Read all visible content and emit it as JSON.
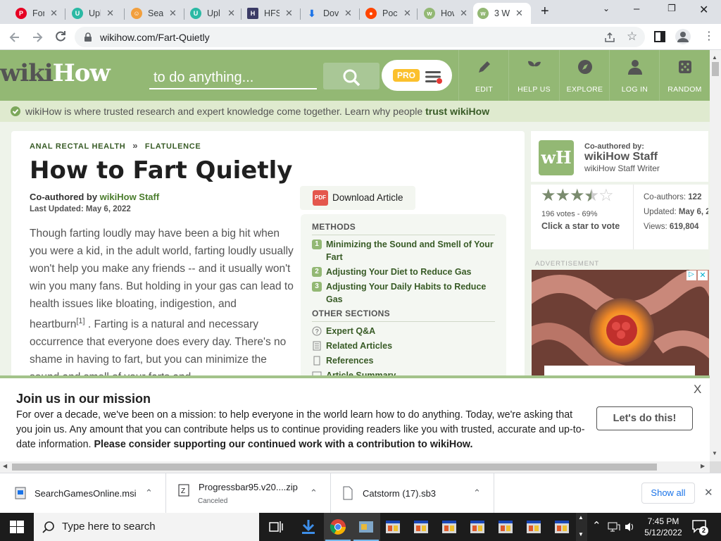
{
  "browser": {
    "tabs": [
      {
        "title": "For",
        "icon": "pinterest-icon",
        "color": "#e60023"
      },
      {
        "title": "Upl",
        "icon": "upload-site-icon",
        "color": "#2bb9a4"
      },
      {
        "title": "Sea",
        "icon": "person-icon",
        "color": "#f29f3d"
      },
      {
        "title": "Upl",
        "icon": "upload-site-icon",
        "color": "#2bb9a4"
      },
      {
        "title": "HFS",
        "icon": "hfs-icon",
        "color": "#3b3b66"
      },
      {
        "title": "Dov",
        "icon": "download-arrow-icon",
        "color": "#1a73e8"
      },
      {
        "title": "Poc",
        "icon": "reddit-icon",
        "color": "#ff4500"
      },
      {
        "title": "How",
        "icon": "wikihow-icon",
        "color": "#93b874"
      },
      {
        "title": "3 W",
        "icon": "wikihow-icon",
        "color": "#93b874",
        "active": true
      }
    ],
    "url": "wikihow.com/Fart-Quietly"
  },
  "site": {
    "logo_dark": "wiki",
    "logo_light": "How",
    "search_placeholder": "to do anything...",
    "pro_label": "PRO",
    "nav": [
      {
        "label": "EDIT",
        "icon": "pencil-icon"
      },
      {
        "label": "HELP US",
        "icon": "sprout-icon"
      },
      {
        "label": "EXPLORE",
        "icon": "compass-icon"
      },
      {
        "label": "LOG IN",
        "icon": "user-icon"
      },
      {
        "label": "RANDOM",
        "icon": "dice-icon"
      }
    ],
    "trust_text": "wikiHow is where trusted research and expert knowledge come together. Learn why people ",
    "trust_link": "trust wikiHow"
  },
  "article": {
    "breadcrumb": [
      "ANAL RECTAL HEALTH",
      "FLATULENCE"
    ],
    "breadcrumb_sep": "»",
    "title": "How to Fart Quietly",
    "coauthor_prefix": "Co-authored by ",
    "coauthor_name": "wikiHow Staff",
    "updated": "Last Updated: May 6, 2022",
    "intro_part1": "Though farting loudly may have been a big hit when you were a kid, in the adult world, farting loudly usually won't help you make any friends -- and it usually won't win you many fans. But holding in your gas can lead to health issues like bloating, indigestion, and heartburn",
    "intro_ref": "[1]",
    "intro_part2": " . Farting is a natural and necessary occurrence that everyone does every day. There's no shame in having to fart, but you can minimize the sound and smell of your farts and...",
    "download_label": "Download Article",
    "pdf_label": "PDF"
  },
  "toc": {
    "methods_heading": "METHODS",
    "methods": [
      {
        "num": "1",
        "label": "Minimizing the Sound and Smell of Your Fart"
      },
      {
        "num": "2",
        "label": "Adjusting Your Diet to Reduce Gas"
      },
      {
        "num": "3",
        "label": "Adjusting Your Daily Habits to Reduce Gas"
      }
    ],
    "other_heading": "OTHER SECTIONS",
    "other": [
      {
        "label": "Expert Q&A",
        "icon": "question-icon"
      },
      {
        "label": "Related Articles",
        "icon": "articles-icon"
      },
      {
        "label": "References",
        "icon": "document-icon"
      },
      {
        "label": "Article Summary",
        "icon": "summary-icon"
      }
    ]
  },
  "sidebar": {
    "coauthored_by": "Co-authored by:",
    "author_name": "wikiHow Staff",
    "author_role": "wikiHow Staff Writer",
    "logo_text": "wH",
    "rating_stars": 3.5,
    "votes": "196 votes - 69%",
    "vote_prompt": "Click a star to vote",
    "coauthors_label": "Co-authors: ",
    "coauthors_value": "122",
    "updated_label": "Updated: ",
    "updated_value": "May 6, 2",
    "views_label": "Views: ",
    "views_value": "619,804",
    "ad_label": "ADVERTISEMENT"
  },
  "banner": {
    "title": "Join us in our mission",
    "text": "For over a decade, we've been on a mission: to help everyone in the world learn how to do anything. Today, we're asking that you join us. Any amount that you can contribute helps us to continue providing readers like you with trusted, accurate and up-to-date information. ",
    "text_bold": "Please consider supporting our continued work with a contribution to wikiHow.",
    "cta": "Let's do this!",
    "close": "X"
  },
  "downloads": {
    "items": [
      {
        "name": "SearchGamesOnline.msi",
        "status": ""
      },
      {
        "name": "Progressbar95.v20....zip",
        "status": "Canceled"
      },
      {
        "name": "Catstorm (17).sb3",
        "status": ""
      }
    ],
    "show_all": "Show all"
  },
  "taskbar": {
    "search_placeholder": "Type here to search",
    "time": "7:45 PM",
    "date": "5/12/2022",
    "notification_count": "2"
  }
}
